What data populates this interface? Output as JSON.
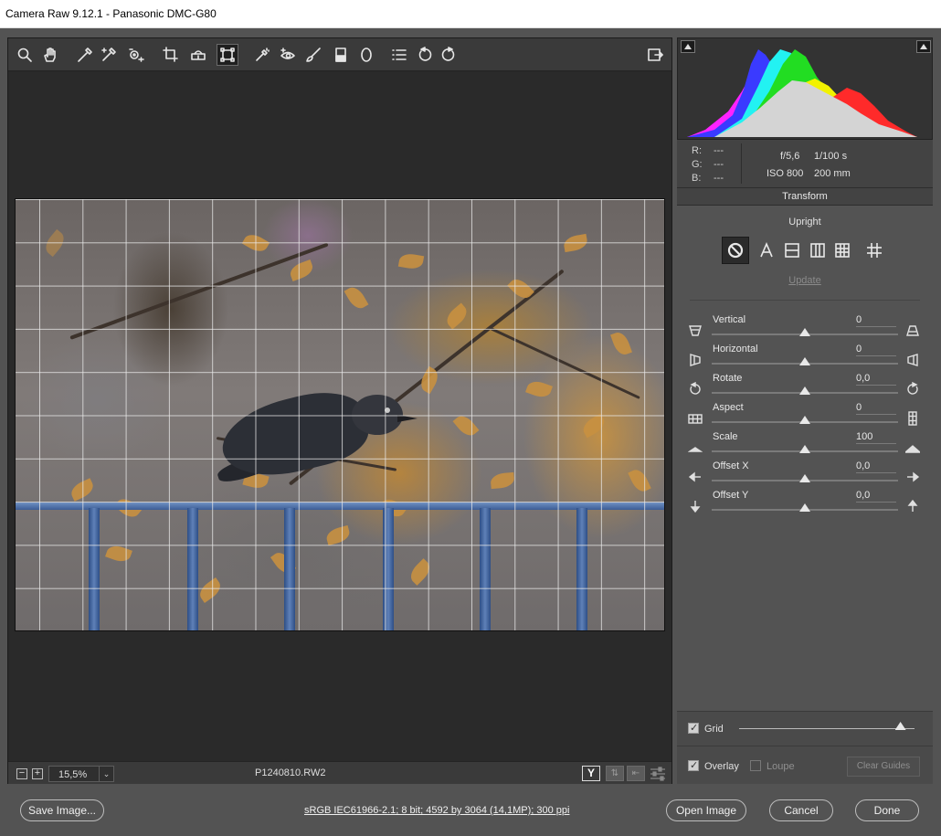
{
  "window": {
    "title": "Camera Raw 9.12.1  -  Panasonic DMC-G80"
  },
  "toolbar": {
    "tools": [
      {
        "name": "zoom-tool",
        "icon": "magnifier-icon"
      },
      {
        "name": "hand-tool",
        "icon": "hand-icon"
      },
      {
        "name": "white-balance-tool",
        "icon": "eyedropper-icon"
      },
      {
        "name": "color-sampler-tool",
        "icon": "color-sampler-icon"
      },
      {
        "name": "targeted-adjustment-tool",
        "icon": "target-adjust-icon"
      },
      {
        "name": "crop-tool",
        "icon": "crop-icon"
      },
      {
        "name": "straighten-tool",
        "icon": "level-icon"
      },
      {
        "name": "transform-tool",
        "icon": "transform-icon",
        "active": true
      },
      {
        "name": "spot-removal-tool",
        "icon": "healing-icon"
      },
      {
        "name": "red-eye-tool",
        "icon": "red-eye-icon"
      },
      {
        "name": "adjustment-brush-tool",
        "icon": "brush-icon"
      },
      {
        "name": "graduated-filter-tool",
        "icon": "gradient-icon"
      },
      {
        "name": "radial-filter-tool",
        "icon": "ellipse-icon"
      },
      {
        "name": "preferences-tool",
        "icon": "list-icon"
      },
      {
        "name": "rotate-ccw-tool",
        "icon": "rotate-left-icon"
      },
      {
        "name": "rotate-cw-tool",
        "icon": "rotate-right-icon"
      }
    ]
  },
  "statusbar": {
    "zoom_out": "−",
    "zoom_in": "+",
    "zoom_value": "15,5%",
    "zoom_dropdown": "⌄",
    "filename": "P1240810.RW2",
    "y_label": "Y"
  },
  "exif": {
    "r_label": "R:",
    "g_label": "G:",
    "b_label": "B:",
    "r_value": "---",
    "g_value": "---",
    "b_value": "---",
    "aperture": "f/5,6",
    "shutter": "1/100 s",
    "iso": "ISO 800",
    "focal": "200 mm"
  },
  "panel": {
    "title": "Transform",
    "upright_label": "Upright",
    "update_label": "Update",
    "sliders": [
      {
        "key": "vertical",
        "label": "Vertical",
        "value": "0",
        "fraction": 0.5
      },
      {
        "key": "horizontal",
        "label": "Horizontal",
        "value": "0",
        "fraction": 0.5
      },
      {
        "key": "rotate",
        "label": "Rotate",
        "value": "0,0",
        "fraction": 0.5
      },
      {
        "key": "aspect",
        "label": "Aspect",
        "value": "0",
        "fraction": 0.5
      },
      {
        "key": "scale",
        "label": "Scale",
        "value": "100",
        "fraction": 0.5
      },
      {
        "key": "offset-x",
        "label": "Offset X",
        "value": "0,0",
        "fraction": 0.5
      },
      {
        "key": "offset-y",
        "label": "Offset Y",
        "value": "0,0",
        "fraction": 0.5
      }
    ]
  },
  "overlay": {
    "grid_label": "Grid",
    "grid_checked": true,
    "grid_fraction": 0.92,
    "overlay_label": "Overlay",
    "overlay_checked": true,
    "loupe_label": "Loupe",
    "loupe_checked": false,
    "clear_guides_label": "Clear Guides"
  },
  "footer": {
    "save_label": "Save Image...",
    "info_text": "sRGB IEC61966-2.1; 8 bit; 4592 by 3064 (14,1MP); 300 ppi",
    "open_label": "Open Image",
    "cancel_label": "Cancel",
    "done_label": "Done"
  },
  "colors": {
    "accent": "#535353",
    "canvas": "#2a2a2a",
    "histogram_red": "#ff2a2a",
    "histogram_green": "#22dd22",
    "histogram_blue": "#3a3aff",
    "histogram_yellow": "#f2f200",
    "histogram_magenta": "#ff22ff",
    "histogram_cyan": "#22f2f2",
    "histogram_luma": "#d4d4d4"
  }
}
